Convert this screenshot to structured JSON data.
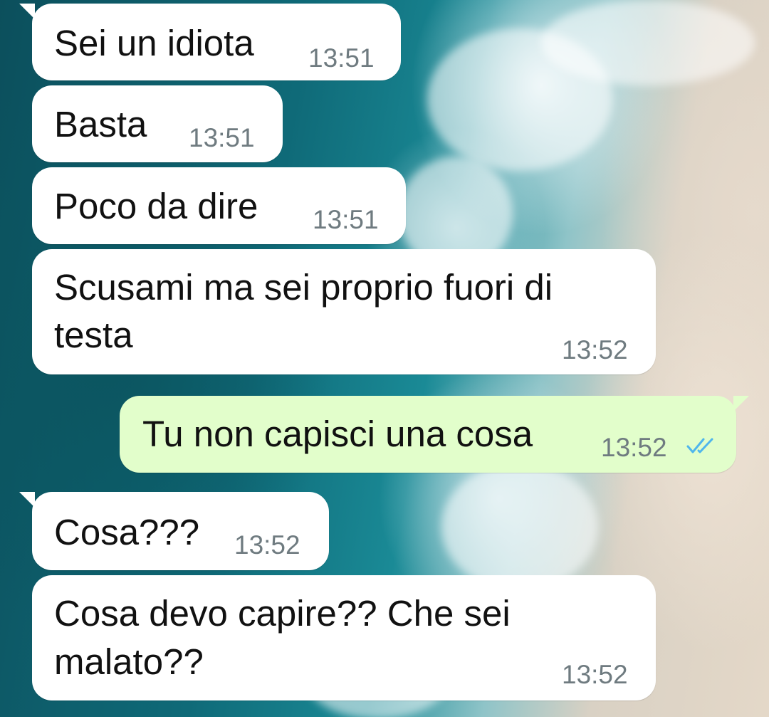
{
  "chat": {
    "messages": [
      {
        "direction": "in",
        "lines": [
          "Sei un idiota"
        ],
        "time": "13:51"
      },
      {
        "direction": "in",
        "lines": [
          "Basta"
        ],
        "time": "13:51"
      },
      {
        "direction": "in",
        "lines": [
          "Poco da dire"
        ],
        "time": "13:51"
      },
      {
        "direction": "in",
        "lines": [
          "Scusami ma sei proprio fuori di",
          "testa"
        ],
        "time": "13:52"
      },
      {
        "direction": "out",
        "lines": [
          "Tu non capisci una cosa"
        ],
        "time": "13:52",
        "status": "read",
        "status_icon": "double-check-icon"
      },
      {
        "direction": "in",
        "lines": [
          "Cosa???"
        ],
        "time": "13:52"
      },
      {
        "direction": "in",
        "lines": [
          "Cosa devo capire?? Che sei",
          "malato??"
        ],
        "time": "13:52"
      }
    ]
  },
  "colors": {
    "incoming_bubble": "#ffffff",
    "outgoing_bubble": "#e2fecb",
    "text": "#111111",
    "timestamp": "#6f7b80",
    "read_ticks": "#4fb6ec"
  },
  "wallpaper": "ocean-beach-aerial"
}
